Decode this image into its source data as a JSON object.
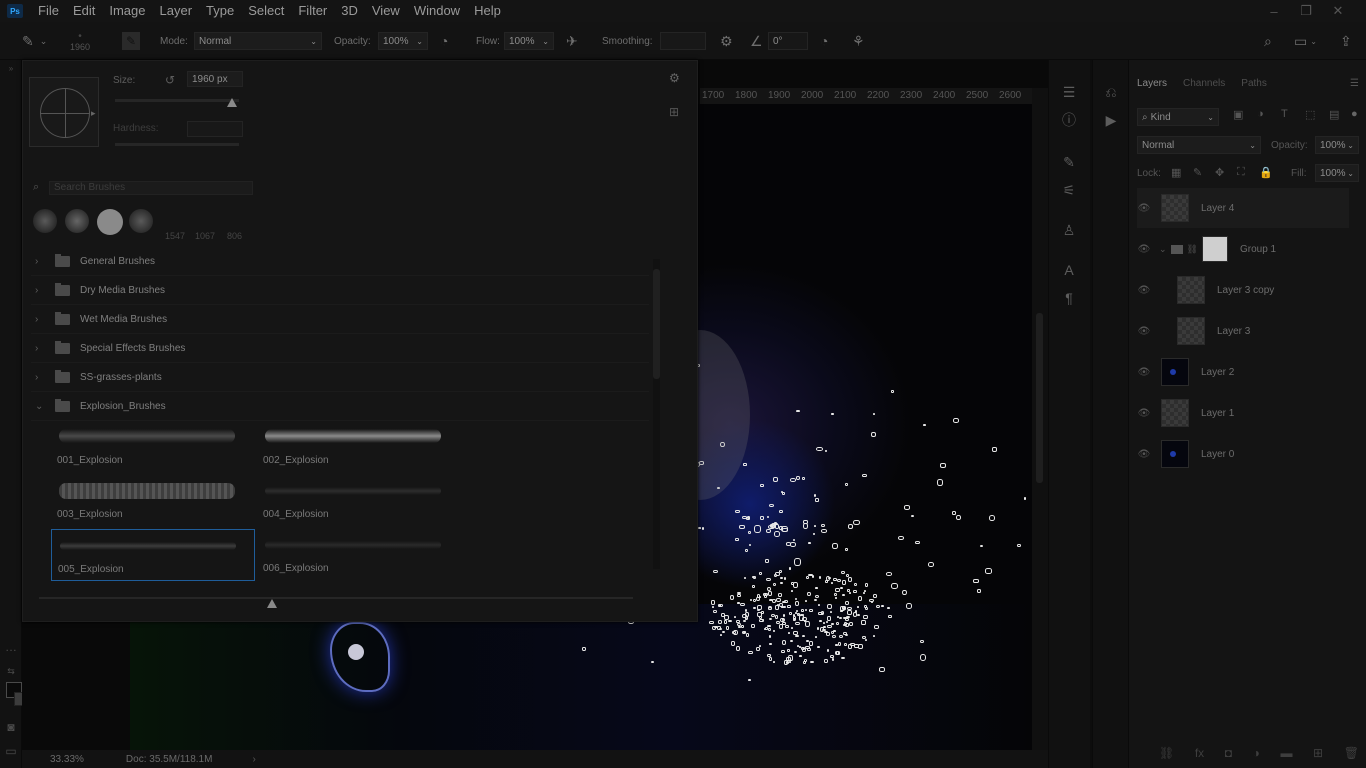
{
  "app": {
    "logo": "Ps"
  },
  "menu": [
    "File",
    "Edit",
    "Image",
    "Layer",
    "Type",
    "Select",
    "Filter",
    "3D",
    "View",
    "Window",
    "Help"
  ],
  "options_bar": {
    "brush_size_preview": "1960",
    "mode_label": "Mode:",
    "mode_value": "Normal",
    "opacity_label": "Opacity:",
    "opacity_value": "100%",
    "flow_label": "Flow:",
    "flow_value": "100%",
    "smoothing_label": "Smoothing:",
    "smoothing_value": "",
    "angle_value": "0°"
  },
  "brush_panel": {
    "size_label": "Size:",
    "size_value": "1960 px",
    "hardness_label": "Hardness:",
    "hardness_value": "",
    "search_placeholder": "Search Brushes",
    "recent_sizes": [
      "1547",
      "1067",
      "806"
    ],
    "folders": [
      {
        "label": "General Brushes",
        "expanded": false
      },
      {
        "label": "Dry Media Brushes",
        "expanded": false
      },
      {
        "label": "Wet Media Brushes",
        "expanded": false
      },
      {
        "label": "Special Effects Brushes",
        "expanded": false
      },
      {
        "label": "SS-grasses-plants",
        "expanded": false
      },
      {
        "label": "Explosion_Brushes",
        "expanded": true
      }
    ],
    "brushes": [
      {
        "name": "001_Explosion",
        "selected": false
      },
      {
        "name": "002_Explosion",
        "selected": false
      },
      {
        "name": "003_Explosion",
        "selected": false
      },
      {
        "name": "004_Explosion",
        "selected": false
      },
      {
        "name": "005_Explosion",
        "selected": true
      },
      {
        "name": "006_Explosion",
        "selected": false
      }
    ]
  },
  "ruler": [
    "1700",
    "1800",
    "1900",
    "2000",
    "2100",
    "2200",
    "2300",
    "2400",
    "2500",
    "2600"
  ],
  "status": {
    "zoom": "33.33%",
    "doc": "Doc: 35.5M/118.1M"
  },
  "layers_panel": {
    "tabs": [
      "Layers",
      "Channels",
      "Paths"
    ],
    "active_tab": "Layers",
    "filter_kind": "Kind",
    "blend_mode": "Normal",
    "opacity_label": "Opacity:",
    "opacity_value": "100%",
    "lock_label": "Lock:",
    "fill_label": "Fill:",
    "fill_value": "100%",
    "layers": [
      {
        "name": "Layer 4",
        "thumb": "transparent",
        "active": true,
        "indent": false
      },
      {
        "name": "Group 1",
        "thumb": "group",
        "active": false,
        "indent": false
      },
      {
        "name": "Layer 3 copy",
        "thumb": "transparent",
        "active": false,
        "indent": true
      },
      {
        "name": "Layer 3",
        "thumb": "transparent",
        "active": false,
        "indent": true
      },
      {
        "name": "Layer 2",
        "thumb": "dark",
        "active": false,
        "indent": false
      },
      {
        "name": "Layer 1",
        "thumb": "transparent",
        "active": false,
        "indent": false
      },
      {
        "name": "Layer 0",
        "thumb": "dark",
        "active": false,
        "indent": false
      }
    ]
  },
  "colors": {
    "accent": "#1f5d9a",
    "background": "#0d0d0d"
  }
}
